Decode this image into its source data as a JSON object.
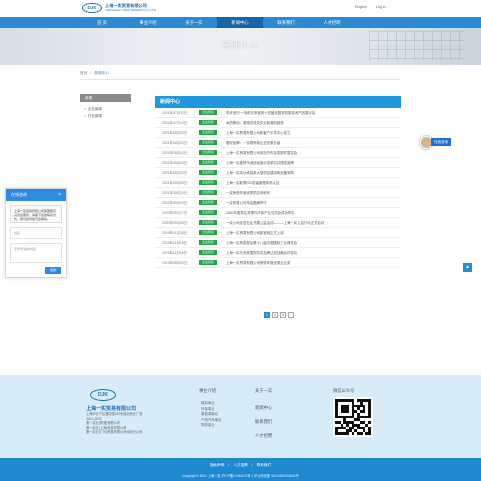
{
  "header": {
    "logo_mark": "DJK",
    "company_cn": "上海一实贸易有限公司",
    "company_en": "SHANGHAI YISHI TRADING CO.,LTD.",
    "top_links": [
      "English",
      "Log in"
    ]
  },
  "nav": {
    "items": [
      "首 页",
      "事业介绍",
      "关于一实",
      "新闻中心",
      "联系我们",
      "人才招聘"
    ],
    "active_index": 3
  },
  "banner": {
    "title": "新闻中心",
    "subtitle": "NEWS"
  },
  "breadcrumb": {
    "home": "首页",
    "separator": "/",
    "current": "新闻中心"
  },
  "sidebar": {
    "title": "新闻",
    "items": [
      "企业新闻",
      "行业新闻"
    ]
  },
  "main": {
    "title": "新闻中心",
    "rows": [
      {
        "date": "2021年07月12日",
        "tag": "企业新闻",
        "title": "举步泥泞:一场前无来者的十四届全国农机新技术产品展示会"
      },
      {
        "date": "2021年07月12日",
        "tag": "企业新闻",
        "title": "木质移动：原观念改变实业新潮流趋势"
      },
      {
        "date": "2021年06月22日",
        "tag": "企业新闻",
        "title": "上海一实贸易有限公司新客户引导中心成立"
      },
      {
        "date": "2021年06月22日",
        "tag": "企业新闻",
        "title": "看好品牌：一实物商城企业形象升级"
      },
      {
        "date": "2021年06月12日",
        "tag": "企业新闻",
        "title": "上海一实贸易有限公司参加汽车及零配件展览会"
      },
      {
        "date": "2021年06月12日",
        "tag": "企业新闻",
        "title": "上海一实被授予诚信经营示范单位并颁发奖牌"
      },
      {
        "date": "2021年06月12日",
        "tag": "企业新闻",
        "title": "上海一实成功承接某大型项目建设和设备采购"
      },
      {
        "date": "2021年05月20日",
        "tag": "企业新闻",
        "title": "上海一实取得ISO质量管理体系认证"
      },
      {
        "date": "2021年05月20日",
        "tag": "企业新闻",
        "title": "一实荣获年度优秀供应商称号"
      },
      {
        "date": "2021年05月20日",
        "tag": "企业新闻",
        "title": "一实贸易公司年会圆满举行"
      },
      {
        "date": "2020年09月17日",
        "tag": "企业新闻",
        "title": "2020年度再生资源与环保产业交流会成功举办"
      },
      {
        "date": "2020年09月08日",
        "tag": "企业新闻",
        "title": "一实公司走进社区开展公益活动———上海一实公益行动正式启动"
      },
      {
        "date": "2019年11月28日",
        "tag": "企业新闻",
        "title": "上海一实贸易有限公司新官网正式上线"
      },
      {
        "date": "2019年11月18日",
        "tag": "企业新闻",
        "title": "上海一实贸易参加第十八届中国国际工业博览会"
      },
      {
        "date": "2019年11月16日",
        "tag": "企业新闻",
        "title": "上海一实与多家国际知名品牌达成战略合作协议"
      },
      {
        "date": "2019年08月20日",
        "tag": "企业新闻",
        "title": "上海一实贸易有限公司荣获年度优秀企业奖"
      }
    ]
  },
  "pagination": {
    "pages": [
      "1",
      "2",
      "3"
    ],
    "current": "1",
    "next": "›"
  },
  "chat": {
    "title": "在线咨询",
    "close": "×",
    "message": "上海一实贸易有限公司客服很高兴为您服务，请留下您的联系方式，我们会尽快与您联系。",
    "name_placeholder": "姓名",
    "phone_placeholder": "手机号/留言内容",
    "send": "发送"
  },
  "float_service": {
    "label": "在线咨询"
  },
  "back_to_top": "▲",
  "footer": {
    "company": "上海一实贸易有限公司",
    "contacts": [
      "上海市长宁区通协路269号建滔商业广场",
      "2001-2003",
      "第一实业(香港)有限公司",
      "第一实业(上海)贸易有限公司",
      "第一实业(广州)贸易有限公司深圳分公司"
    ],
    "col1_title": "事业介绍",
    "col1_links": [
      "模拟事业",
      "环保事业",
      "新能源事业",
      "产机汽车事业",
      "物流事业"
    ],
    "col2_title": "关于一实",
    "col2_links": [
      "新闻中心",
      "联系我们",
      "人才招聘"
    ],
    "qr_title": "微信公众号"
  },
  "bottom": {
    "links": [
      "隐私声明",
      "/",
      "人才招聘",
      "/",
      "联系我们"
    ],
    "copyright": "Copyright © 2021 上海一实 沪ICP备17044071号-1   沪公网安备 31010502000642号"
  }
}
